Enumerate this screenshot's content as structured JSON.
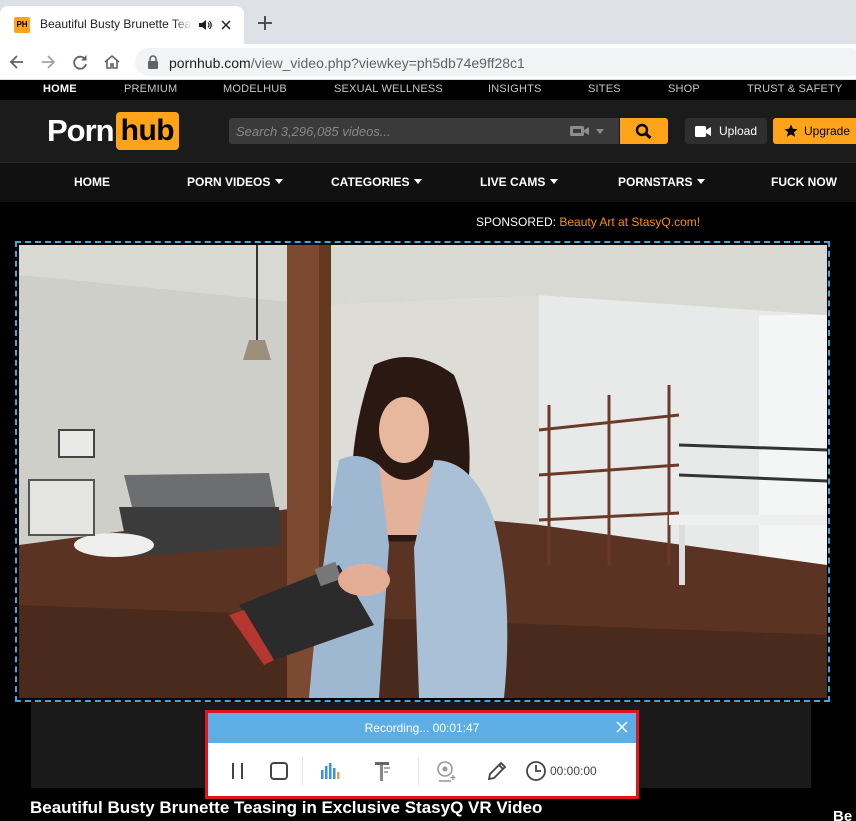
{
  "browser": {
    "tab_title": "Beautiful Busty Brunette Teasing in Exclusive StasyQ VR Video",
    "favicon_text": "PH",
    "url_host": "pornhub.com",
    "url_path": "/view_video.php?viewkey=ph5db74e9ff28c1"
  },
  "topnav": [
    "HOME",
    "PREMIUM",
    "MODELHUB",
    "SEXUAL WELLNESS",
    "INSIGHTS",
    "SITES",
    "SHOP",
    "TRUST & SAFETY"
  ],
  "logo": {
    "left": "Porn",
    "right": "hub"
  },
  "search": {
    "placeholder": "Search 3,296,085 videos..."
  },
  "header_buttons": {
    "upload": "Upload",
    "upgrade": "Upgrade"
  },
  "mainnav": [
    "HOME",
    "PORN VIDEOS",
    "CATEGORIES",
    "LIVE CAMS",
    "PORNSTARS",
    "FUCK NOW"
  ],
  "sponsored": {
    "label": "SPONSORED:",
    "link": "Beauty Art at StasyQ.com!"
  },
  "recorder": {
    "status": "Recording... 00:01:47",
    "timer": "00:00:00"
  },
  "video_title": "Beautiful Busty Brunette Teasing in Exclusive StasyQ VR Video",
  "right_edge_text": "Be",
  "colors": {
    "brand": "#ffa31a",
    "recorder_header": "#5eaee6",
    "recorder_border": "#e0161e",
    "selection": "#3fa7e0"
  }
}
